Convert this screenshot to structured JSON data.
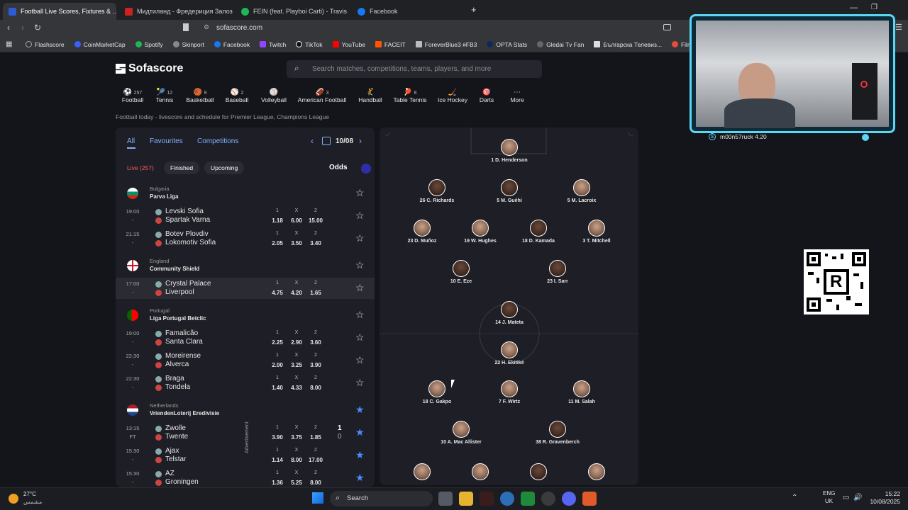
{
  "browser": {
    "tabs": [
      {
        "title": "Football Live Scores, Fixtures & …",
        "active": true
      },
      {
        "title": "Мидтиланд - Фредериция Залози …",
        "active": false
      },
      {
        "title": "FEIN (feat. Playboi Carti) - Travis …",
        "active": false
      },
      {
        "title": "Facebook",
        "active": false
      }
    ],
    "url": "sofascore.com",
    "bookmarks": [
      "Flashscore",
      "CoinMarketCap",
      "Spotify",
      "Skinport",
      "Facebook",
      "Twitch",
      "TikTok",
      "YouTube",
      "FACEIT",
      "ForeverBlue3 #FB3",
      "OPTA Stats",
      "Gledai Tv Fan",
      "Българска Телевиз...",
      "Filmizip - Филми"
    ]
  },
  "site": {
    "logo": "Sofascore",
    "search_placeholder": "Search matches, competitions, teams, players, and more",
    "subtitle": "Football today - livescore and schedule for Premier League, Champions League",
    "sports": [
      {
        "count": "257",
        "label": "Football"
      },
      {
        "count": "12",
        "label": "Tennis"
      },
      {
        "count": "9",
        "label": "Basketball"
      },
      {
        "count": "2",
        "label": "Baseball"
      },
      {
        "count": "",
        "label": "Volleyball"
      },
      {
        "count": "3",
        "label": "American Football"
      },
      {
        "count": "",
        "label": "Handball"
      },
      {
        "count": "8",
        "label": "Table Tennis"
      },
      {
        "count": "",
        "label": "Ice Hockey"
      },
      {
        "count": "",
        "label": "Darts"
      },
      {
        "count": "",
        "label": "More"
      }
    ]
  },
  "matches_panel": {
    "tabs": [
      "All",
      "Favourites",
      "Competitions"
    ],
    "date": "10/08",
    "filters": [
      "Live (257)",
      "Finished",
      "Upcoming"
    ],
    "odds_label": "Odds",
    "leagues": [
      {
        "country": "Bulgaria",
        "name": "Parva Liga",
        "star": "☆",
        "matches": [
          {
            "time": "19:00",
            "status": "-",
            "home": "Levski Sofia",
            "away": "Spartak Varna",
            "o1": "1.18",
            "ox": "6.00",
            "o2": "15.00"
          },
          {
            "time": "21:15",
            "status": "-",
            "home": "Botev Plovdiv",
            "away": "Lokomotiv Sofia",
            "o1": "2.05",
            "ox": "3.50",
            "o2": "3.40"
          }
        ]
      },
      {
        "country": "England",
        "name": "Community Shield",
        "star": "☆",
        "matches": [
          {
            "time": "17:00",
            "status": "-",
            "home": "Crystal Palace",
            "away": "Liverpool",
            "o1": "4.75",
            "ox": "4.20",
            "o2": "1.65"
          }
        ]
      },
      {
        "country": "Portugal",
        "name": "Liga Portugal Betclic",
        "star": "☆",
        "matches": [
          {
            "time": "19:00",
            "status": "-",
            "home": "Famalicão",
            "away": "Santa Clara",
            "o1": "2.25",
            "ox": "2.90",
            "o2": "3.60"
          },
          {
            "time": "22:30",
            "status": "-",
            "home": "Moreirense",
            "away": "Alverca",
            "o1": "2.00",
            "ox": "3.25",
            "o2": "3.90"
          },
          {
            "time": "22:30",
            "status": "-",
            "home": "Braga",
            "away": "Tondela",
            "o1": "1.40",
            "ox": "4.33",
            "o2": "8.00"
          }
        ]
      },
      {
        "country": "Netherlands",
        "name": "VriendenLoterij Eredivisie",
        "star": "★",
        "matches": [
          {
            "time": "13:15",
            "status": "FT",
            "home": "Zwolle",
            "away": "Twente",
            "o1": "3.90",
            "ox": "3.75",
            "o2": "1.85",
            "sh": "1",
            "sa": "0"
          },
          {
            "time": "15:30",
            "status": "-",
            "home": "Ajax",
            "away": "Telstar",
            "o1": "1.14",
            "ox": "8.00",
            "o2": "17.00"
          },
          {
            "time": "15:30",
            "status": "-",
            "home": "AZ",
            "away": "Groningen",
            "o1": "1.36",
            "ox": "5.25",
            "o2": "8.00"
          }
        ]
      }
    ],
    "odds_headers": [
      "1",
      "X",
      "2"
    ],
    "advertisement": "Advertisement"
  },
  "lineup": {
    "players": [
      {
        "name": "1 D. Henderson"
      },
      {
        "name": "26 C. Richards"
      },
      {
        "name": "5 M. Guéhi"
      },
      {
        "name": "5 M. Lacroix"
      },
      {
        "name": "23 D. Muñoz"
      },
      {
        "name": "19 W. Hughes"
      },
      {
        "name": "18 D. Kamada"
      },
      {
        "name": "3 T. Mitchell"
      },
      {
        "name": "10 E. Eze"
      },
      {
        "name": "23 I. Sarr"
      },
      {
        "name": "14 J. Mateta"
      },
      {
        "name": "22 H. Ekitiké"
      },
      {
        "name": "18 C. Gakpo"
      },
      {
        "name": "7 F. Wirtz"
      },
      {
        "name": "11 M. Salah"
      },
      {
        "name": "10 A. Mac Allister"
      },
      {
        "name": "38 R. Gravenberch"
      },
      {
        "name": ""
      },
      {
        "name": ""
      },
      {
        "name": ""
      },
      {
        "name": ""
      }
    ]
  },
  "stream_overlay": {
    "username": "m00n57ruck 4.20"
  },
  "taskbar": {
    "weather_temp": "27°C",
    "weather_desc": "مشمس",
    "search": "Search",
    "lang": "ENG",
    "region": "UK",
    "time": "15:22",
    "date": "10/08/2025"
  }
}
